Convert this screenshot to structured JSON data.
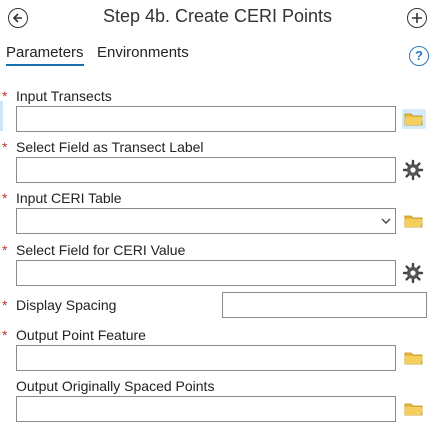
{
  "header": {
    "title": "Step 4b. Create CERI Points",
    "back_icon": "back-arrow-icon",
    "add_icon": "add-icon"
  },
  "tabs": [
    {
      "label": "Parameters",
      "active": true
    },
    {
      "label": "Environments",
      "active": false
    }
  ],
  "help_icon": "help-icon",
  "required_marker": "*",
  "params": {
    "input_transects": {
      "label": "Input Transects",
      "value": "",
      "required": true,
      "icon": "folder-icon"
    },
    "transect_label_field": {
      "label": "Select Field as Transect Label",
      "value": "",
      "required": true,
      "icon": "gear-icon"
    },
    "ceri_table": {
      "label": "Input CERI Table",
      "value": "",
      "required": true,
      "icon": "folder-icon",
      "dropdown": true
    },
    "ceri_value_field": {
      "label": "Select Field for CERI Value",
      "value": "",
      "required": true,
      "icon": "gear-icon"
    },
    "display_spacing": {
      "label": "Display Spacing",
      "value": "",
      "required": true
    },
    "output_point_feature": {
      "label": "Output Point Feature",
      "value": "",
      "required": true,
      "icon": "folder-icon"
    },
    "output_spaced_points": {
      "label": "Output Originally Spaced Points",
      "value": "",
      "required": false,
      "icon": "folder-icon"
    }
  },
  "colors": {
    "accent": "#1a6fb0",
    "required": "#c0392b",
    "folder": "#e9b93a"
  }
}
